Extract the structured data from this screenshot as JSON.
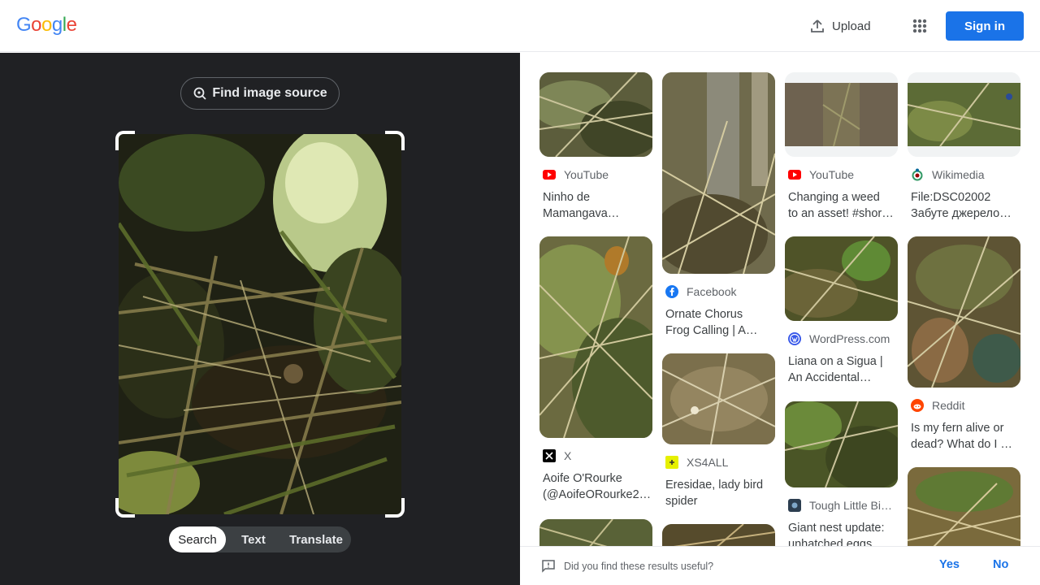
{
  "header": {
    "logo_letters": [
      {
        "ch": "G",
        "color": "#4285F4"
      },
      {
        "ch": "o",
        "color": "#EA4335"
      },
      {
        "ch": "o",
        "color": "#FBBC05"
      },
      {
        "ch": "g",
        "color": "#4285F4"
      },
      {
        "ch": "l",
        "color": "#34A853"
      },
      {
        "ch": "e",
        "color": "#EA4335"
      }
    ],
    "upload_label": "Upload",
    "signin_label": "Sign in",
    "accent": "#1a73e8"
  },
  "lens": {
    "find_source_label": "Find image source",
    "tabs": [
      {
        "label": "Search",
        "active": true
      },
      {
        "label": "Text",
        "active": false
      },
      {
        "label": "Translate",
        "active": false
      }
    ]
  },
  "results": {
    "col1": [
      {
        "source": "YouTube",
        "icon": "youtube-icon",
        "title1": "Ninho de",
        "title2": "Mamangava…"
      },
      {
        "source": "X",
        "icon": "x-icon",
        "title1": "Aoife O'Rourke",
        "title2": "(@AoifeORourke2…"
      }
    ],
    "col2": [
      {
        "source": "Facebook",
        "icon": "facebook-icon",
        "title1": "Ornate Chorus",
        "title2": "Frog Calling | A…"
      },
      {
        "source": "XS4ALL",
        "icon": "xs4all-icon",
        "title1": "Eresidae, lady bird",
        "title2": "spider"
      }
    ],
    "col3": [
      {
        "source": "YouTube",
        "icon": "youtube-icon",
        "title1": "Changing a weed",
        "title2": "to an asset! #shor…"
      },
      {
        "source": "WordPress.com",
        "icon": "wordpress-icon",
        "title1": "Liana on a Sigua |",
        "title2": "An Accidental…"
      },
      {
        "source": "Tough Little Bi…",
        "icon": "site-icon",
        "title1": "Giant nest update:",
        "title2": "unhatched eggs,…"
      }
    ],
    "col4": [
      {
        "source": "Wikimedia",
        "icon": "wikimedia-icon",
        "title1": "File:DSC02002",
        "title2": "Забуте джерело…"
      },
      {
        "source": "Reddit",
        "icon": "reddit-icon",
        "title1": "Is my fern alive or",
        "title2": "dead? What do I …"
      }
    ]
  },
  "feedback": {
    "question": "Did you find these results useful?",
    "yes_label": "Yes",
    "no_label": "No"
  }
}
